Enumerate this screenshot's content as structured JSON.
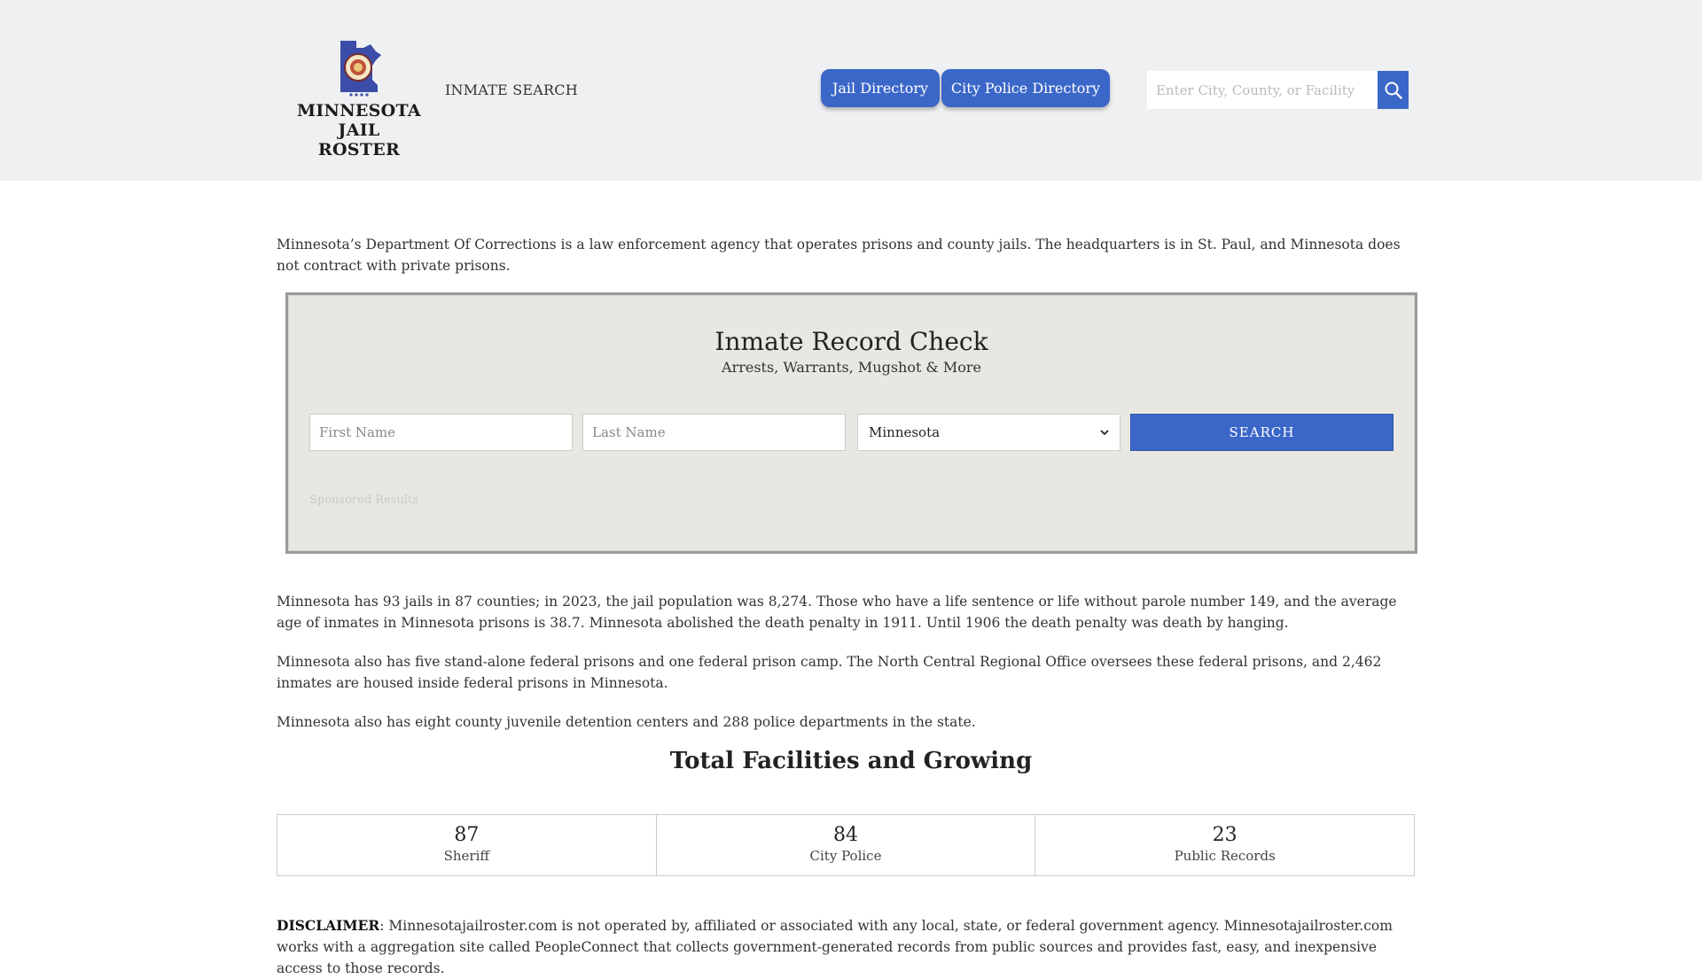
{
  "header": {
    "logo_line1": "MINNESOTA",
    "logo_line2": "JAIL ROSTER",
    "nav_inmate_search": "INMATE SEARCH",
    "jail_directory": "Jail Directory",
    "city_police_directory": "City Police Directory",
    "search_placeholder": "Enter City, County, or Facility",
    "search_icon": "magnifier-icon",
    "accent_color": "#3b67c9"
  },
  "intro": "Minnesota’s Department Of Corrections is a law enforcement agency that operates prisons and county jails. The headquarters is in St. Paul, and Minnesota does not contract with private prisons.",
  "record_check": {
    "title": "Inmate Record Check",
    "subtitle": "Arrests, Warrants, Mugshot & More",
    "first_name_placeholder": "First Name",
    "last_name_placeholder": "Last Name",
    "state_selected": "Minnesota",
    "search_label": "SEARCH",
    "sponsored": "Sponsored Results"
  },
  "paragraphs": {
    "p2": "Minnesota has 93 jails in 87 counties; in 2023, the jail population was 8,274. Those who have a life sentence or life without parole number 149, and the average age of inmates in Minnesota prisons is 38.7. Minnesota abolished the death penalty in 1911. Until 1906 the death penalty was death by hanging.",
    "p3": "Minnesota also has five stand-alone federal prisons and one federal prison camp. The North Central Regional Office oversees these federal prisons, and 2,462 inmates are housed inside federal prisons in Minnesota.",
    "p4": "Minnesota also has eight county juvenile detention centers and 288 police departments in the state."
  },
  "facilities": {
    "heading": "Total Facilities and Growing",
    "stats": [
      {
        "value": "87",
        "label": "Sheriff"
      },
      {
        "value": "84",
        "label": "City Police"
      },
      {
        "value": "23",
        "label": "Public Records"
      }
    ]
  },
  "disclaimer": {
    "label": "DISCLAIMER",
    "text": ": Minnesotajailroster.com is not operated by, affiliated or associated with any local, state, or federal government agency. Minnesotajailroster.com works with a aggregation site called PeopleConnect that collects government-generated records from public sources and provides fast, easy, and inexpensive access to those records."
  }
}
